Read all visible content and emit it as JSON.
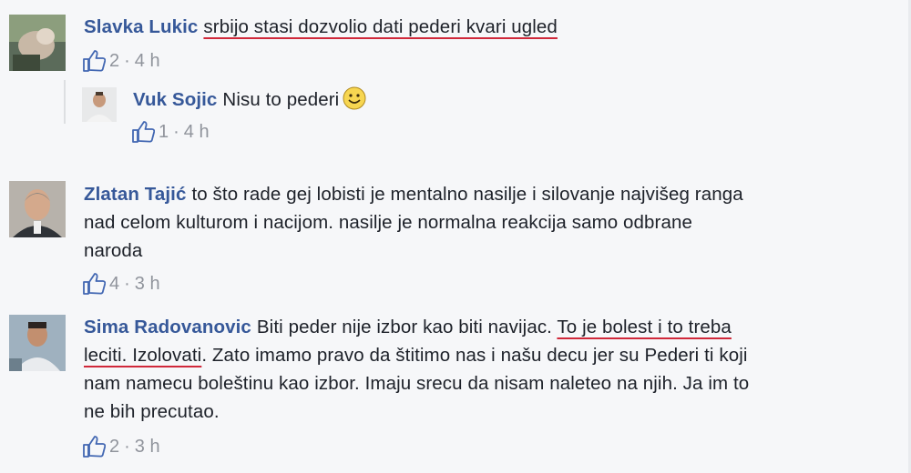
{
  "comments": [
    {
      "author": "Slavka Lukic",
      "text": "srbijo stasi dozvolio dati pederi kvari ugled",
      "likes": "2",
      "time": "4 h",
      "replies": [
        {
          "author": "Vuk Sojic",
          "text": "Nisu to pederi",
          "likes": "1",
          "time": "4 h",
          "emoji": "smile-emoji"
        }
      ]
    },
    {
      "author": "Zlatan Tajić",
      "text_lines": [
        "to što rade gej lobisti je mentalno nasilje i silovanje najvišeg ranga",
        "nad celom kulturom i nacijom. nasilje je normalna reakcija samo odbrane",
        "naroda"
      ],
      "likes": "4",
      "time": "3 h"
    },
    {
      "author": "Sima Radovanovic",
      "line1_plain": "Biti peder nije izbor kao biti navijac. ",
      "line1_underlined": "To je bolest i to treba",
      "line2_underlined": "leciti. Izolovati",
      "line2_plain": ". Zato imamo pravo da štitimo nas i našu decu jer su Pederi ti koji",
      "line3": "nam namecu boleštinu kao izbor. Imaju srecu da nisam naleteo na njih. Ja im to",
      "line4": "ne bih precutao.",
      "likes": "2",
      "time": "3 h"
    }
  ],
  "meta_separator": "·",
  "icons": {
    "like": "thumbs-up-icon"
  },
  "colors": {
    "author": "#365899",
    "meta": "#90949c",
    "underline": "#d0283a",
    "background": "#f6f7f9"
  }
}
